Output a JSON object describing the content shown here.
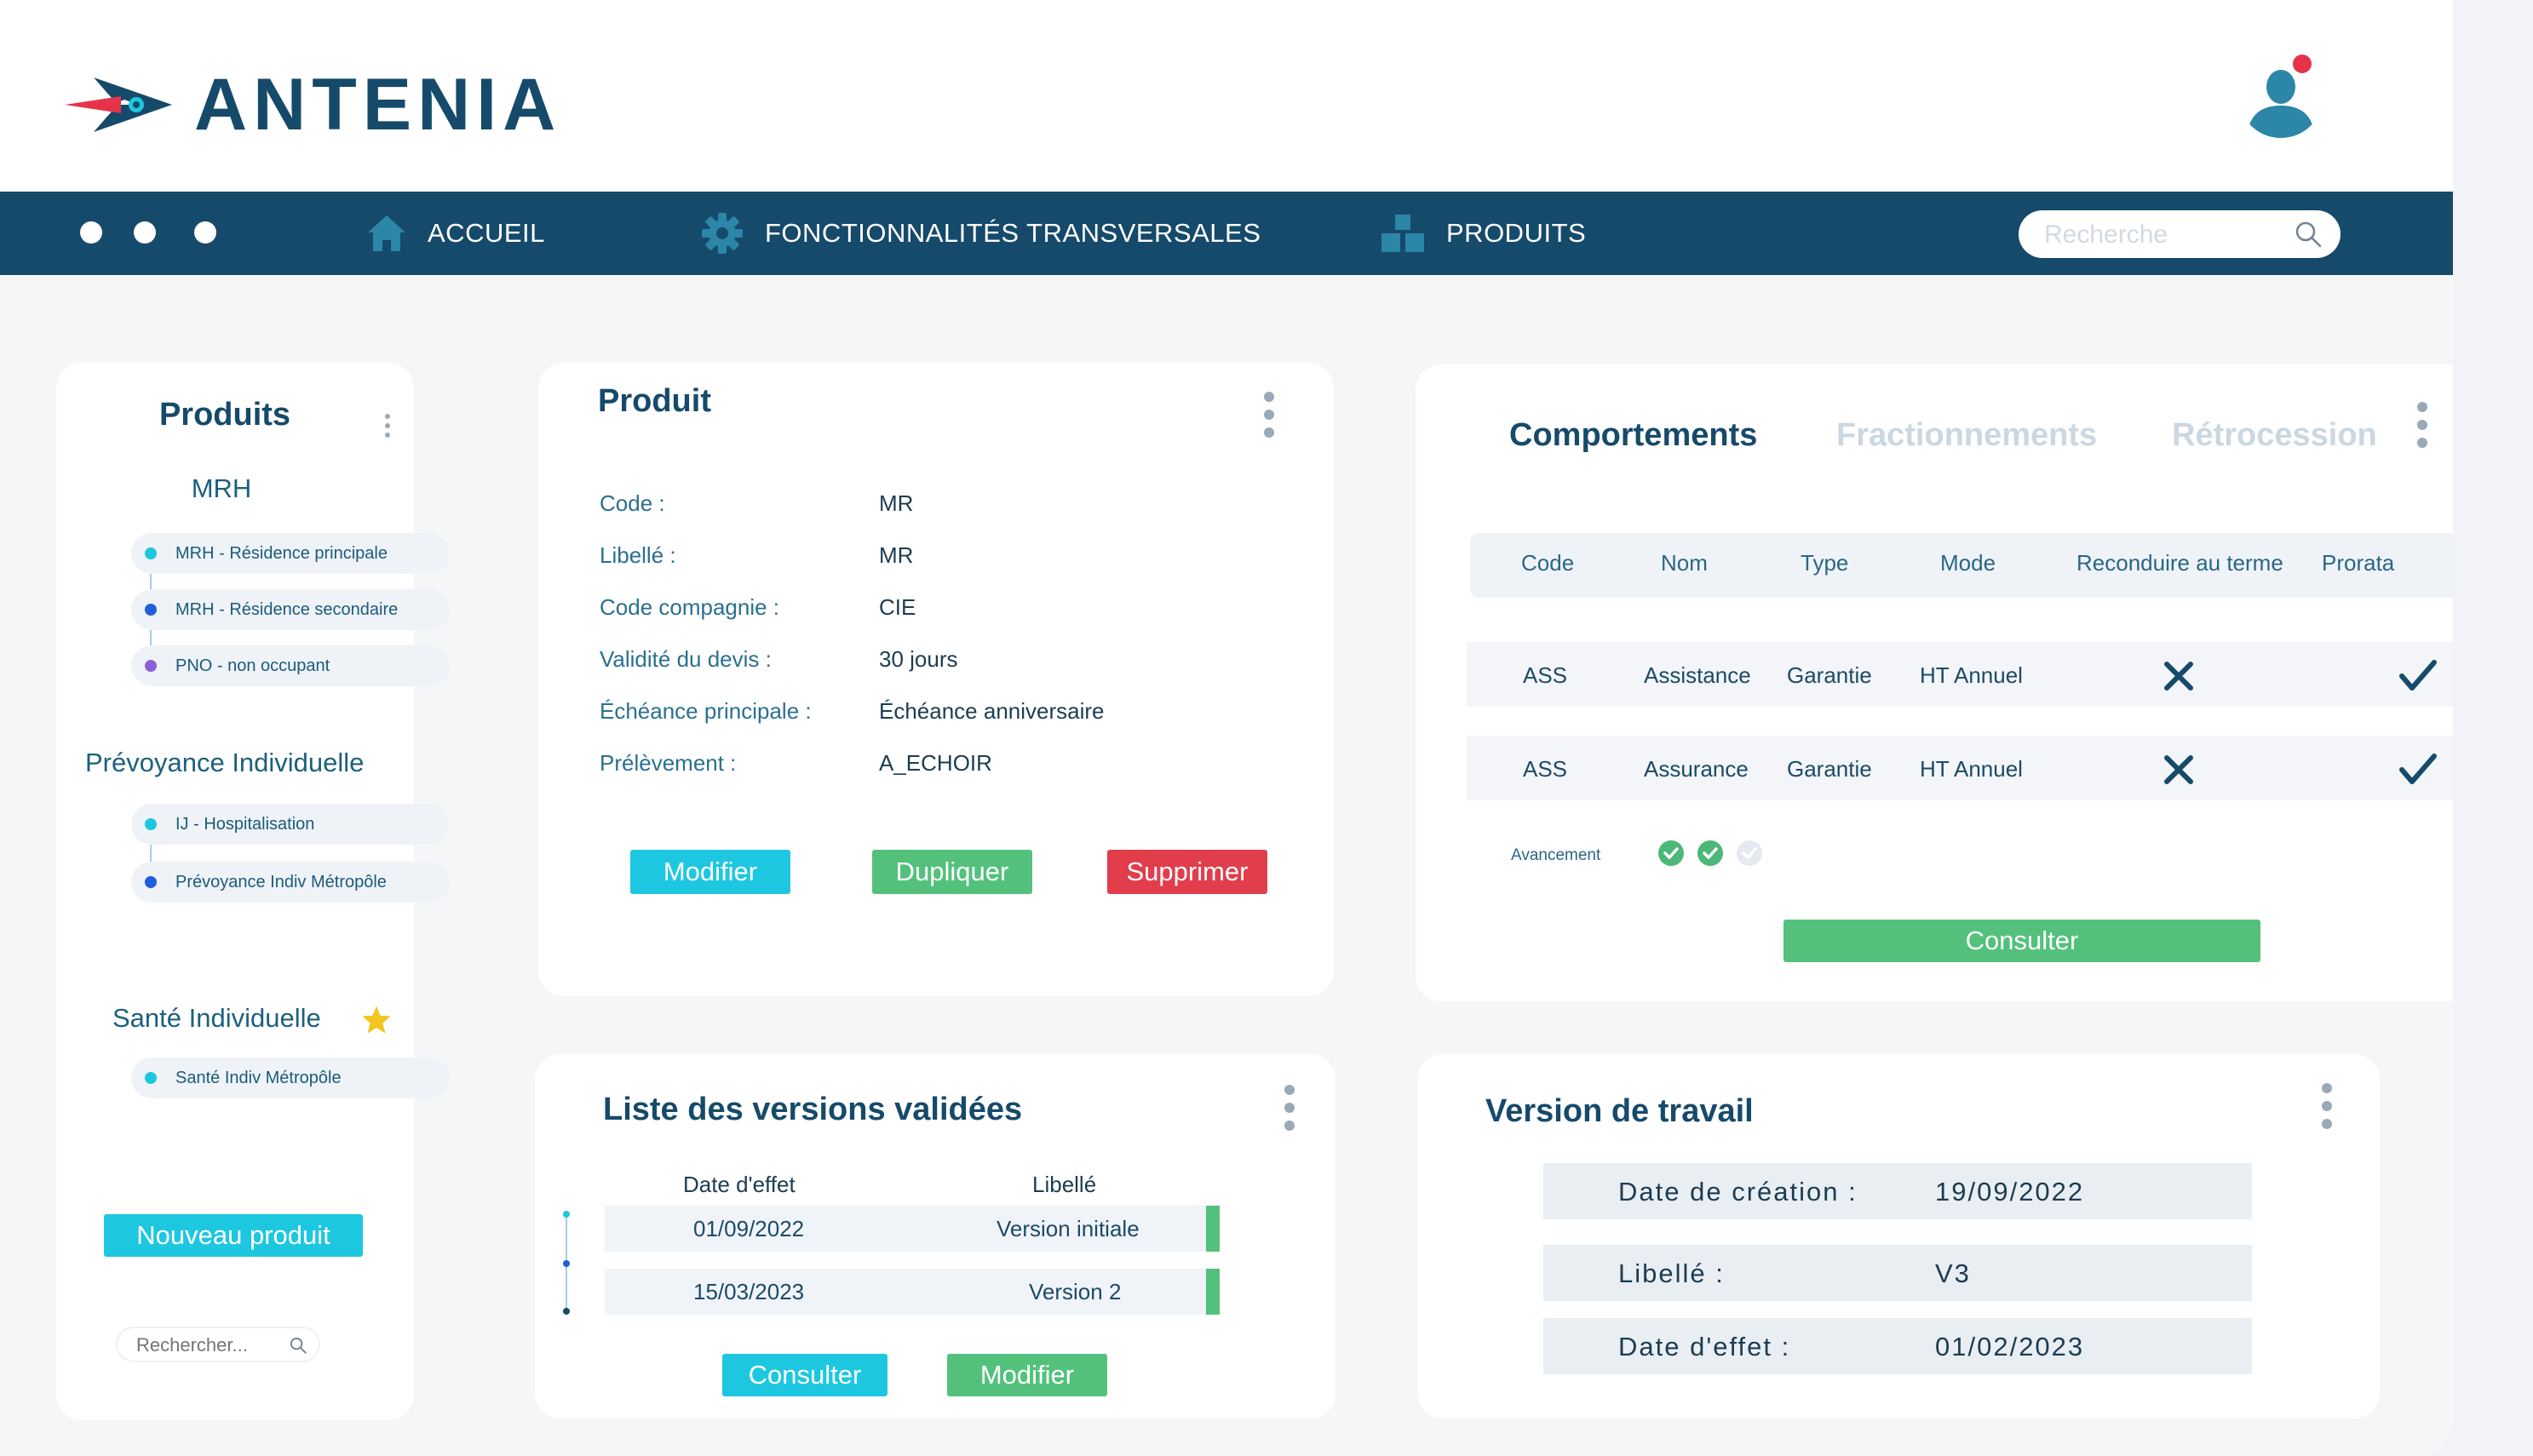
{
  "app": {
    "brand": "ANTENIA"
  },
  "nav": {
    "items": [
      {
        "label": "ACCUEIL",
        "icon": "home-icon"
      },
      {
        "label": "FONCTIONNALITÉS TRANSVERSALES",
        "icon": "gear-icon"
      },
      {
        "label": "PRODUITS",
        "icon": "boxes-icon"
      }
    ],
    "search_placeholder": "Recherche"
  },
  "sidebar": {
    "title": "Produits",
    "groups": [
      {
        "title": "MRH",
        "items": [
          {
            "label": "MRH - Résidence principale",
            "color": "#1ec7e0"
          },
          {
            "label": "MRH - Résidence secondaire",
            "color": "#1f5fdc"
          },
          {
            "label": "PNO - non occupant",
            "color": "#8a5fd8"
          }
        ]
      },
      {
        "title": "Prévoyance Individuelle",
        "items": [
          {
            "label": "IJ - Hospitalisation",
            "color": "#1ec7e0"
          },
          {
            "label": "Prévoyance Indiv Métropôle",
            "color": "#1f5fdc"
          }
        ]
      },
      {
        "title": "Santé Individuelle",
        "items": [
          {
            "label": "Santé Indiv Métropôle",
            "color": "#1ec7e0"
          }
        ]
      }
    ],
    "new_button": "Nouveau produit",
    "search_placeholder": "Rechercher..."
  },
  "produit": {
    "title": "Produit",
    "fields": [
      {
        "label": "Code :",
        "value": "MR"
      },
      {
        "label": "Libellé :",
        "value": "MR"
      },
      {
        "label": "Code compagnie :",
        "value": "CIE"
      },
      {
        "label": "Validité du devis :",
        "value": "30 jours"
      },
      {
        "label": "Échéance principale :",
        "value": "Échéance anniversaire"
      },
      {
        "label": "Prélèvement :",
        "value": "A_ECHOIR"
      }
    ],
    "buttons": {
      "modify": "Modifier",
      "duplicate": "Dupliquer",
      "delete": "Supprimer"
    }
  },
  "comportements": {
    "tabs": [
      "Comportements",
      "Fractionnements",
      "Rétrocession"
    ],
    "columns": [
      "Code",
      "Nom",
      "Type",
      "Mode",
      "Reconduire au terme",
      "Prorata"
    ],
    "rows": [
      {
        "code": "ASS",
        "nom": "Assistance",
        "type": "Garantie",
        "mode": "HT Annuel",
        "reconduire": false,
        "prorata": true,
        "accent": "#e13d4b"
      },
      {
        "code": "ASS",
        "nom": "Assurance",
        "type": "Garantie",
        "mode": "HT Annuel",
        "reconduire": false,
        "prorata": true,
        "accent": "#2b86a8"
      }
    ],
    "progress_label": "Avancement",
    "progress_steps": 3,
    "progress_done": 2,
    "consult_button": "Consulter"
  },
  "versions": {
    "title": "Liste des versions validées",
    "columns": [
      "Date d'effet",
      "Libellé"
    ],
    "rows": [
      {
        "date": "01/09/2022",
        "label": "Version initiale"
      },
      {
        "date": "15/03/2023",
        "label": "Version 2"
      }
    ],
    "buttons": {
      "consult": "Consulter",
      "modify": "Modifier"
    }
  },
  "travail": {
    "title": "Version de travail",
    "fields": [
      {
        "label": "Date de création :",
        "value": "19/09/2022"
      },
      {
        "label": "Libellé :",
        "value": "V3"
      },
      {
        "label": "Date d'effet :",
        "value": "01/02/2023"
      }
    ]
  },
  "colors": {
    "primary": "#164a6a",
    "cyan": "#1ec7e0",
    "green": "#53c17c",
    "red": "#e13d4b",
    "star": "#f2c521"
  }
}
